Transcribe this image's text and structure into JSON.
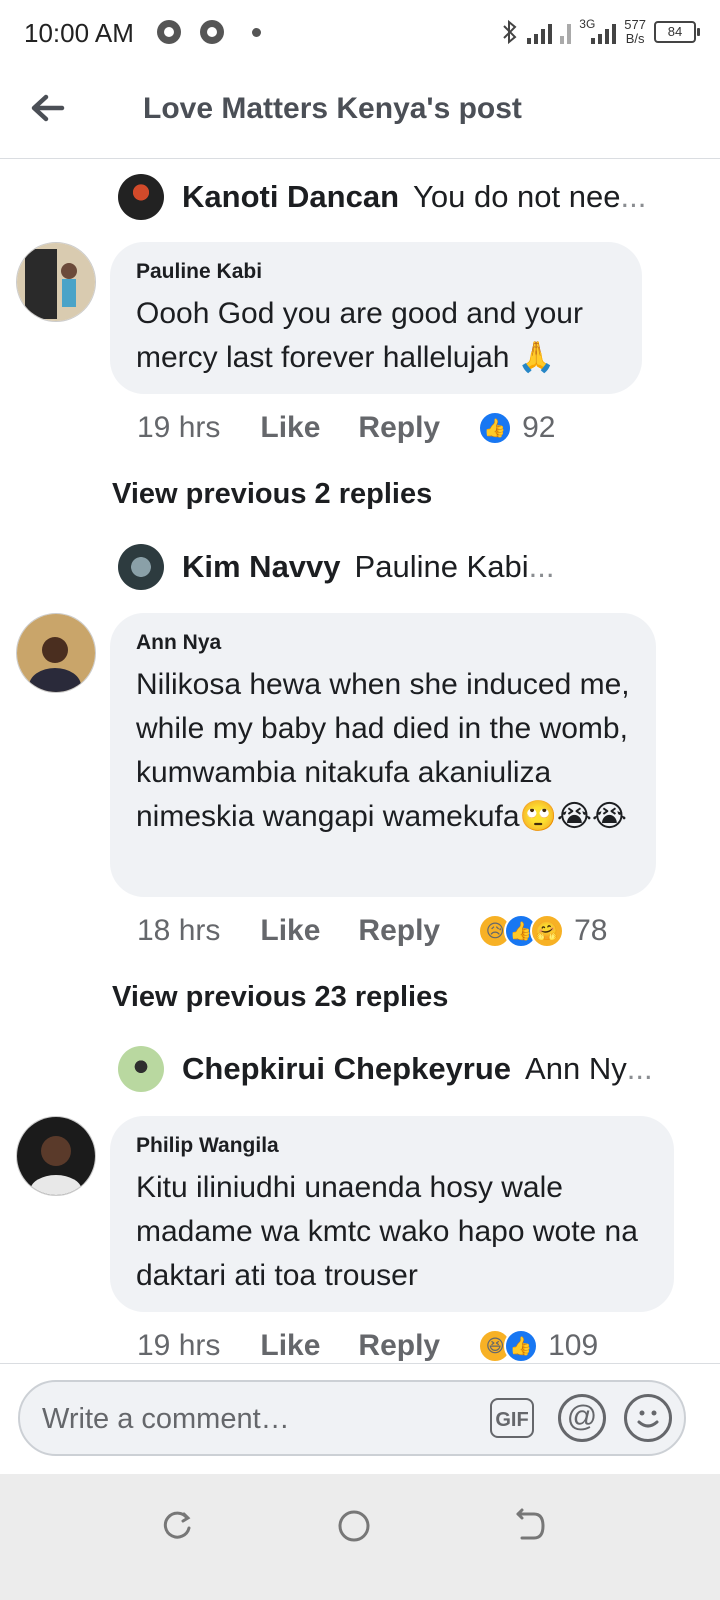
{
  "status_bar": {
    "time": "10:00 AM",
    "network": "3G",
    "speed_value": "577",
    "speed_unit": "B/s",
    "battery": "84"
  },
  "header": {
    "title": "Love Matters Kenya's post"
  },
  "threads": [
    {
      "reply_preview": {
        "name": "Kanoti Dancan",
        "text": "You do not nee",
        "ellipsis": "..."
      },
      "comment": {
        "name": "Pauline Kabi",
        "text": "Oooh God you are good and your mercy last forever hallelujah 🙏",
        "time": "19 hrs",
        "like": "Like",
        "reply": "Reply",
        "reactions": [
          "like"
        ],
        "count": "92"
      },
      "view_previous": "View previous 2 replies"
    },
    {
      "reply_preview": {
        "name": "Kim Navvy",
        "text": "Pauline Kabi ",
        "ellipsis": "..."
      },
      "comment": {
        "name": "Ann Nya",
        "text": "Nilikosa hewa when she induced me, while my baby had died in the womb, kumwambia nitakufa akaniuliza nimeskia wangapi wamekufa🙄😭😭",
        "time": "18 hrs",
        "like": "Like",
        "reply": "Reply",
        "reactions": [
          "sad",
          "like",
          "care"
        ],
        "count": "78"
      },
      "view_previous": "View previous 23 replies"
    },
    {
      "reply_preview": {
        "name": "Chepkirui Chepkeyrue",
        "text": "Ann Ny",
        "ellipsis": "..."
      },
      "comment": {
        "name": "Philip Wangila",
        "text": "Kitu iliniudhi unaenda hosy wale madame wa kmtc wako hapo wote na daktari  ati toa trouser",
        "time": "19 hrs",
        "like": "Like",
        "reply": "Reply",
        "reactions": [
          "haha",
          "like"
        ],
        "count": "109"
      }
    }
  ],
  "composer": {
    "placeholder": "Write a comment…",
    "gif_label": "GIF",
    "mention_label": "@"
  },
  "icons": {
    "back": "back-arrow-icon",
    "gif": "gif-icon",
    "mention": "at-mention-icon",
    "emoji": "emoji-icon",
    "nav_recents": "recents-icon",
    "nav_home": "home-icon",
    "nav_back": "nav-back-icon"
  }
}
